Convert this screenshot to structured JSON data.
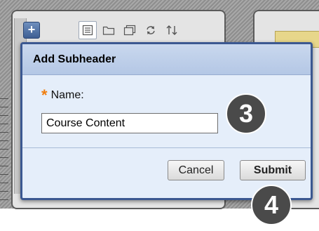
{
  "toolbar": {
    "add_label": "+",
    "icons": [
      "list-view-icon",
      "folder-icon",
      "window-icon",
      "refresh-icon",
      "sort-icon"
    ]
  },
  "dialog": {
    "title": "Add Subheader",
    "name_label": "Name:",
    "required_marker": "*",
    "name_value": "Course Content",
    "cancel_label": "Cancel",
    "submit_label": "Submit"
  },
  "steps": {
    "step_three": "3",
    "step_four": "4"
  },
  "colors": {
    "dialog_border": "#3b5891",
    "dialog_header": "#b4c7e5",
    "dialog_body": "#e5eefa",
    "required_star": "#f07d0d",
    "step_badge": "#4a4a4a"
  }
}
